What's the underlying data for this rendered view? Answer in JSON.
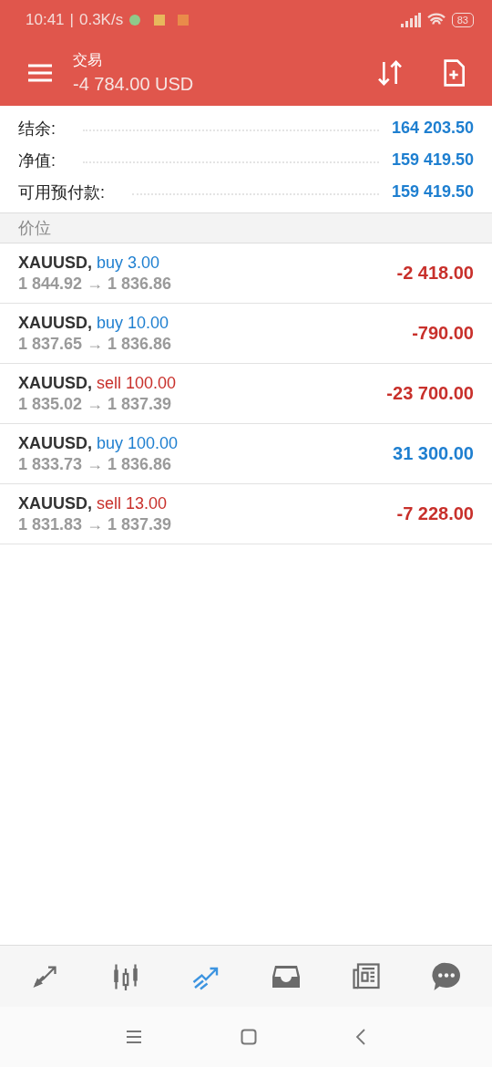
{
  "status_bar": {
    "time": "10:41",
    "separator": "|",
    "speed": "0.3K/s",
    "battery": "83"
  },
  "header": {
    "title": "交易",
    "balance": "-4 784.00 USD"
  },
  "summary": [
    {
      "label": "结余:",
      "value": "164 203.50"
    },
    {
      "label": "净值:",
      "value": "159 419.50"
    },
    {
      "label": "可用预付款:",
      "value": "159 419.50"
    }
  ],
  "section_title": "价位",
  "positions": [
    {
      "symbol": "XAUUSD,",
      "order": "buy 3.00",
      "kind": "buy",
      "prices": "1 844.92 → 1 836.86",
      "profit": "-2 418.00",
      "loss": true
    },
    {
      "symbol": "XAUUSD,",
      "order": "buy 10.00",
      "kind": "buy",
      "prices": "1 837.65 → 1 836.86",
      "profit": "-790.00",
      "loss": true
    },
    {
      "symbol": "XAUUSD,",
      "order": "sell 100.00",
      "kind": "sell",
      "prices": "1 835.02 → 1 837.39",
      "profit": "-23 700.00",
      "loss": true
    },
    {
      "symbol": "XAUUSD,",
      "order": "buy 100.00",
      "kind": "buy",
      "prices": "1 833.73 → 1 836.86",
      "profit": "31 300.00",
      "loss": false
    },
    {
      "symbol": "XAUUSD,",
      "order": "sell 13.00",
      "kind": "sell",
      "prices": "1 831.83 → 1 837.39",
      "profit": "-7 228.00",
      "loss": true
    }
  ],
  "bottom_nav": [
    {
      "kind": "quotes",
      "selected": false
    },
    {
      "kind": "chart",
      "selected": false
    },
    {
      "kind": "trade",
      "selected": true
    },
    {
      "kind": "history",
      "selected": false
    },
    {
      "kind": "news",
      "selected": false
    },
    {
      "kind": "messages",
      "selected": false
    }
  ]
}
